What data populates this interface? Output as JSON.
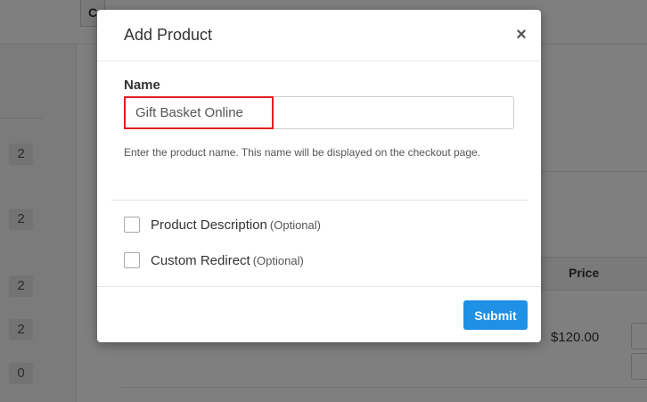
{
  "background": {
    "top_button_label": "C",
    "badges": [
      "2",
      "2",
      "2",
      "2",
      "0"
    ],
    "price_header": "Price",
    "row_price": "$120.00"
  },
  "modal": {
    "title": "Add Product",
    "close_label": "×",
    "name_label": "Name",
    "name_value": "Gift Basket Online",
    "name_placeholder": "",
    "help_text": "Enter the product name. This name will be displayed on the checkout page.",
    "options": [
      {
        "label": "Product Description",
        "tag": "(Optional)",
        "checked": false
      },
      {
        "label": "Custom Redirect",
        "tag": "(Optional)",
        "checked": false
      }
    ],
    "submit_label": "Submit"
  },
  "colors": {
    "accent": "#1e90e6",
    "highlight": "#e02020",
    "overlay": "#000000"
  }
}
